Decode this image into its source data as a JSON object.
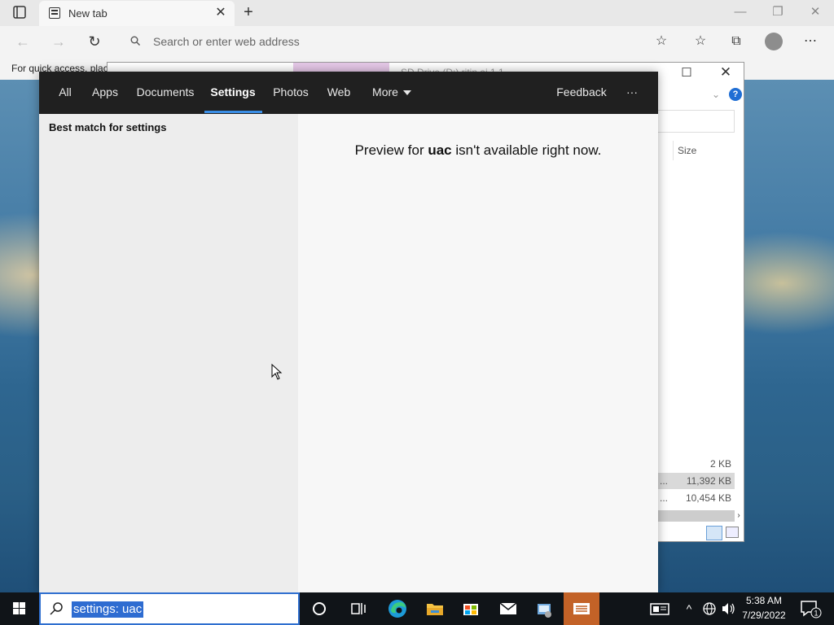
{
  "browser": {
    "tab_title": "New tab",
    "address_placeholder": "Search or enter web address",
    "favorites_bar_text": "For quick access, plac"
  },
  "explorer": {
    "title": "SD Drive (D:)   ritin   ai 1.1",
    "size_header": "Size",
    "rows": [
      {
        "name": "",
        "size": "2 KB"
      },
      {
        "name": "...",
        "size": "11,392 KB"
      },
      {
        "name": "...",
        "size": "10,454 KB"
      }
    ]
  },
  "search": {
    "tabs": [
      "All",
      "Apps",
      "Documents",
      "Settings",
      "Photos",
      "Web"
    ],
    "more_label": "More",
    "active_tab": "Settings",
    "feedback_label": "Feedback",
    "ellipsis_label": "···",
    "best_match_label": "Best match for settings",
    "preview_prefix": "Preview for ",
    "preview_term": "uac",
    "preview_suffix": " isn't available right now.",
    "query": "settings: uac"
  },
  "taskbar": {
    "time": "5:38 AM",
    "date": "7/29/2022",
    "notification_count": "1"
  },
  "colors": {
    "taskbar_bg": "#101418",
    "search_tabs_bg": "#202020",
    "accent_blue": "#3a8ee6",
    "active_app_orange": "#c36227"
  }
}
